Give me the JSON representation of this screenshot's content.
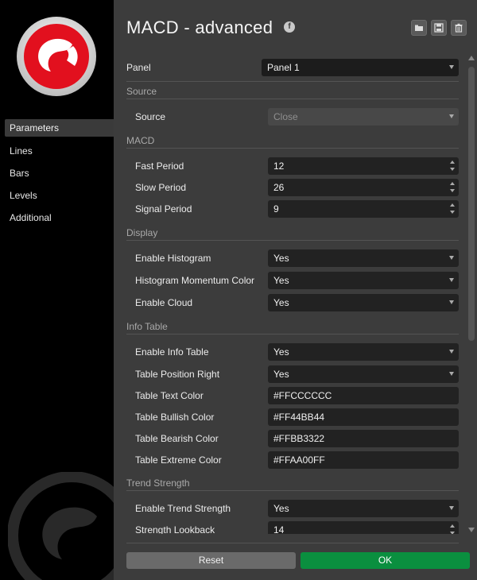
{
  "title": "MACD - advanced",
  "sidebar": {
    "items": [
      {
        "label": "Parameters",
        "active": true
      },
      {
        "label": "Lines"
      },
      {
        "label": "Bars"
      },
      {
        "label": "Levels"
      },
      {
        "label": "Additional"
      }
    ]
  },
  "colors": {
    "accent_ok": "#0a8f3f",
    "logo_red": "#e2101e"
  },
  "form": {
    "panel": {
      "label": "Panel",
      "value": "Panel 1"
    },
    "source_section": "Source",
    "source": {
      "label": "Source",
      "value": "Close"
    },
    "macd_section": "MACD",
    "fast_period": {
      "label": "Fast Period",
      "value": "12"
    },
    "slow_period": {
      "label": "Slow Period",
      "value": "26"
    },
    "signal_period": {
      "label": "Signal Period",
      "value": "9"
    },
    "display_section": "Display",
    "enable_histogram": {
      "label": "Enable Histogram",
      "value": "Yes"
    },
    "histogram_momentum_color": {
      "label": "Histogram Momentum Color",
      "value": "Yes"
    },
    "enable_cloud": {
      "label": "Enable Cloud",
      "value": "Yes"
    },
    "info_table_section": "Info Table",
    "enable_info_table": {
      "label": "Enable Info Table",
      "value": "Yes"
    },
    "table_position_right": {
      "label": "Table Position Right",
      "value": "Yes"
    },
    "table_text_color": {
      "label": "Table Text Color",
      "value": "#FFCCCCCC"
    },
    "table_bullish_color": {
      "label": "Table Bullish Color",
      "value": "#FF44BB44"
    },
    "table_bearish_color": {
      "label": "Table Bearish Color",
      "value": "#FFBB3322"
    },
    "table_extreme_color": {
      "label": "Table Extreme Color",
      "value": "#FFAA00FF"
    },
    "trend_strength_section": "Trend Strength",
    "enable_trend_strength": {
      "label": "Enable Trend Strength",
      "value": "Yes"
    },
    "strength_lookback": {
      "label": "Strength Lookback",
      "value": "14"
    }
  },
  "footer": {
    "reset_label": "Reset",
    "ok_label": "OK"
  }
}
